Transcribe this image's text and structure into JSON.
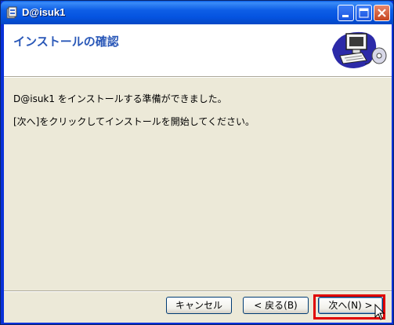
{
  "window": {
    "title": "D@isuk1"
  },
  "header": {
    "title": "インストールの確認"
  },
  "body": {
    "line1": "D@isuk1 をインストールする準備ができました。",
    "line2": "[次へ]をクリックしてインストールを開始してください。"
  },
  "buttons": {
    "cancel": "キャンセル",
    "back": "< 戻る(B)",
    "next": "次へ(N) >"
  },
  "colors": {
    "titlebar": "#0553e0",
    "header_title": "#2a58b8",
    "highlight": "#e00000",
    "panel": "#ece9d8"
  },
  "icons": [
    "app-icon",
    "minimize-icon",
    "maximize-icon",
    "close-icon",
    "computer-setup-icon",
    "mouse-cursor-icon"
  ]
}
